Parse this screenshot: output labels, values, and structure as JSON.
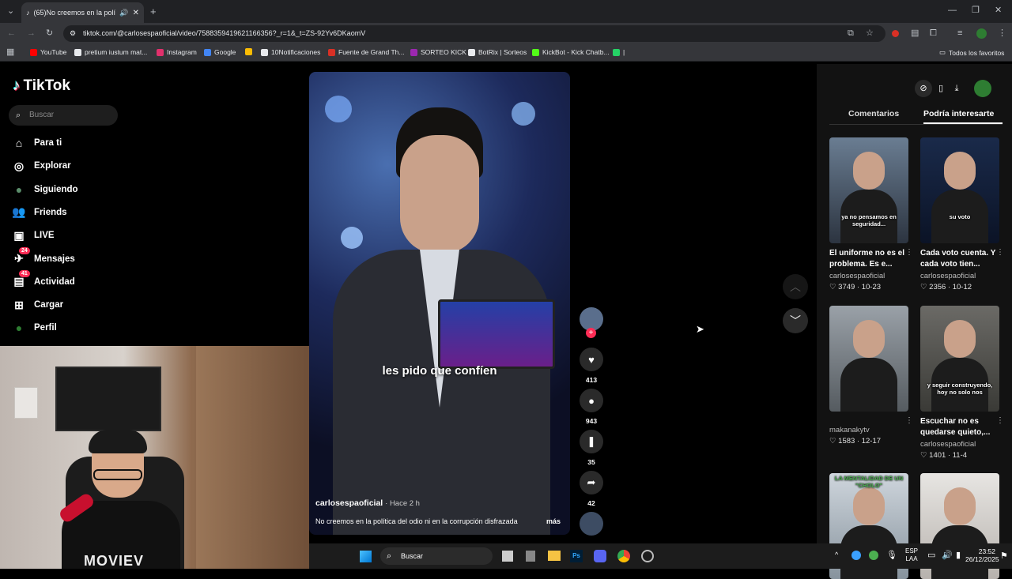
{
  "browser": {
    "tab_title": "(65)No creemos en la polít",
    "url": "tiktok.com/@carlosespaoficial/video/7588359419621166356?_r=1&_t=ZS-92Yv6DKaomV",
    "bookmarks": [
      {
        "label": "YouTube",
        "color": "#ff0000"
      },
      {
        "label": "pretium iustum mat...",
        "color": "#e8eaed"
      },
      {
        "label": "Instagram",
        "color": "#e1306c"
      },
      {
        "label": "Google",
        "color": "#4285f4"
      },
      {
        "label": "",
        "color": "#fbbc04"
      },
      {
        "label": "10Notificaciones",
        "color": "#e8eaed"
      },
      {
        "label": "Fuente de Grand Th...",
        "color": "#d93025"
      },
      {
        "label": "SORTEO KICK",
        "color": "#9c27b0"
      },
      {
        "label": "BotRix | Sorteos",
        "color": "#e8eaed"
      },
      {
        "label": "KickBot - Kick Chatb...",
        "color": "#53fc18"
      },
      {
        "label": "|",
        "color": "#25d366"
      }
    ],
    "all_bookmarks": "Todos los favoritos"
  },
  "sidebar": {
    "logo": "TikTok",
    "search_placeholder": "Buscar",
    "items": [
      {
        "label": "Para ti",
        "icon": "home-icon"
      },
      {
        "label": "Explorar",
        "icon": "compass-icon"
      },
      {
        "label": "Siguiendo",
        "icon": "following-icon"
      },
      {
        "label": "Friends",
        "icon": "friends-icon"
      },
      {
        "label": "LIVE",
        "icon": "live-icon"
      },
      {
        "label": "Mensajes",
        "icon": "messages-icon",
        "badge": "24"
      },
      {
        "label": "Actividad",
        "icon": "activity-icon",
        "badge": "41"
      },
      {
        "label": "Cargar",
        "icon": "upload-icon"
      },
      {
        "label": "Perfil",
        "icon": "profile-icon"
      }
    ]
  },
  "video": {
    "caption_overlay": "les pido que confíen",
    "author": "carlosespaoficial",
    "time": "· Hace 2 h",
    "description": "No creemos en la política del odio ni en la corrupción disfrazada",
    "more": "más",
    "likes": "413",
    "comments": "943",
    "saves": "35",
    "shares": "42"
  },
  "panel": {
    "tabs": [
      "Comentarios",
      "Podría interesarte"
    ],
    "cards": [
      {
        "title": "El uniforme no es el problema. Es e...",
        "user": "carlosespaoficial",
        "stats": "♡ 3749 · 10-23",
        "overlay": "ya no pensamos en seguridad..."
      },
      {
        "title": "Cada voto cuenta. Y cada voto tien...",
        "user": "carlosespaoficial",
        "stats": "♡ 2356 · 10-12",
        "overlay": "su voto"
      },
      {
        "title": "",
        "user": "makanakytv",
        "stats": "♡ 1583 · 12-17",
        "overlay": ""
      },
      {
        "title": "Escuchar no es quedarse quieto,...",
        "user": "carlosespaoficial",
        "stats": "♡ 1401 · 11-4",
        "overlay": "y seguir construyendo, hoy no solo nos"
      },
      {
        "title": "",
        "user": "",
        "stats": "",
        "overlay": "LA MENTALIDAD DE UN \"CHOLO\""
      },
      {
        "title": "",
        "user": "",
        "stats": "",
        "overlay": ""
      }
    ]
  },
  "taskbar": {
    "search": "Buscar",
    "lang_top": "ESP",
    "lang_bottom": "LAA",
    "time": "23:52",
    "date": "26/12/2025"
  },
  "webcam": {
    "shirt_text": "MOVIEV"
  },
  "colors": {
    "accent": "#fe2c55",
    "tiktok_cyan": "#25f4ee"
  }
}
